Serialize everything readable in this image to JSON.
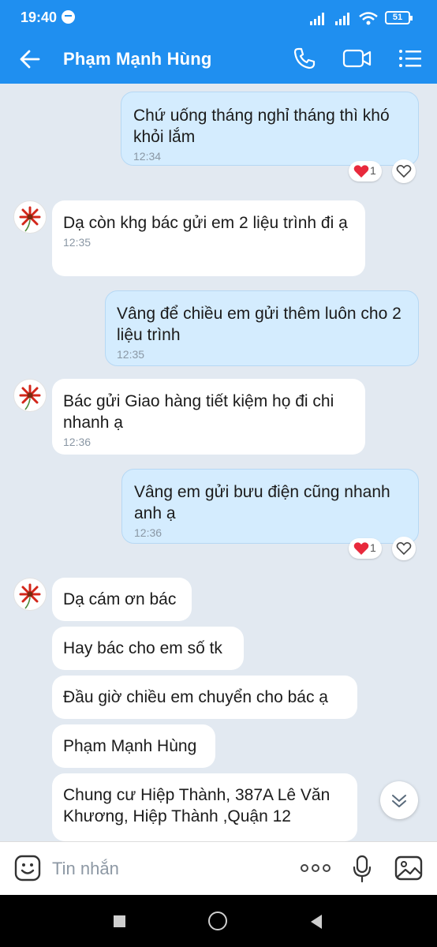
{
  "status_bar": {
    "time": "19:40",
    "battery": "51",
    "messenger_icon": "messenger-icon",
    "signal_icons": [
      "signal-icon",
      "signal-icon",
      "wifi-icon",
      "battery-icon"
    ]
  },
  "header": {
    "contact_name": "Phạm Mạnh Hùng",
    "icons": [
      "back-arrow-icon",
      "phone-icon",
      "video-call-icon",
      "menu-list-icon"
    ]
  },
  "messages": [
    {
      "dir": "out",
      "text": "Chứ uống tháng nghỉ tháng thì khó khỏi lắm",
      "time": "12:34",
      "reaction_count": "1"
    },
    {
      "dir": "in",
      "text": "Dạ còn khg bác gửi em 2 liệu trình đi ạ",
      "time": "12:35"
    },
    {
      "dir": "out",
      "text": "Vâng để chiều em gửi thêm luôn cho 2 liệu trình",
      "time": "12:35"
    },
    {
      "dir": "in",
      "text": "Bác gửi Giao hàng tiết kiệm họ đi chi nhanh ạ",
      "time": "12:36"
    },
    {
      "dir": "out",
      "text": "Vâng em gửi bưu điện cũng nhanh anh ạ",
      "time": "12:36",
      "reaction_count": "1"
    },
    {
      "dir": "in",
      "text": "Dạ cám ơn bác"
    },
    {
      "dir": "in",
      "text": "Hay bác cho em số tk"
    },
    {
      "dir": "in",
      "text": "Đầu giờ chiều em chuyển cho bác  ạ"
    },
    {
      "dir": "in",
      "text": "Phạm Mạnh Hùng"
    },
    {
      "dir": "in",
      "text": "Chung cư Hiệp Thành, 387A Lê Văn Khương, Hiệp Thành ,Quận 12"
    }
  ],
  "input": {
    "placeholder": "Tin nhắn",
    "icons": [
      "emoji-icon",
      "more-dots-icon",
      "microphone-icon",
      "image-icon"
    ]
  },
  "colors": {
    "header_blue": "#1f8ff0",
    "chat_background": "#e2e9f1",
    "outgoing_bubble": "#d4ecfe",
    "incoming_bubble": "#ffffff",
    "heart_red": "#e8293c"
  }
}
